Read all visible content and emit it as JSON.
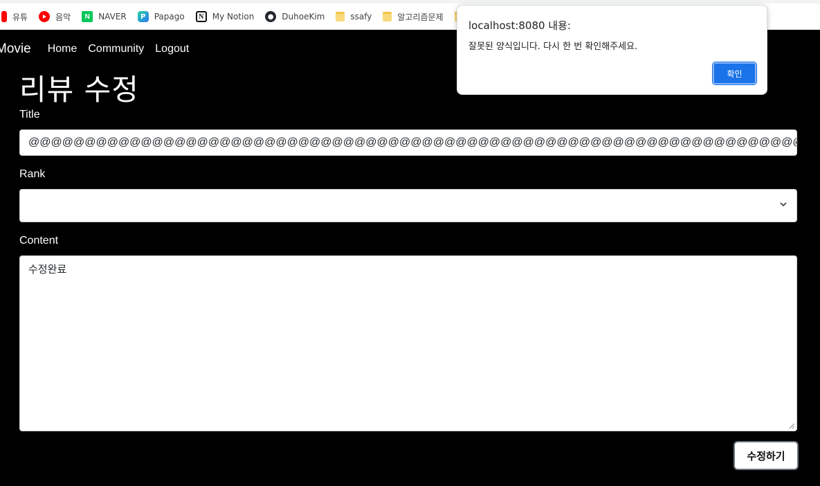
{
  "bookmarks": [
    {
      "label": "유튜",
      "icon": "youtube-icon"
    },
    {
      "label": "음악",
      "icon": "youtube-music-icon"
    },
    {
      "label": "NAVER",
      "icon": "naver-icon"
    },
    {
      "label": "Papago",
      "icon": "papago-icon"
    },
    {
      "label": "My Notion",
      "icon": "notion-icon"
    },
    {
      "label": "DuhoeKim",
      "icon": "github-icon"
    },
    {
      "label": "ssafy",
      "icon": "folder-icon"
    },
    {
      "label": "알고리즘문제",
      "icon": "folder-icon"
    },
    {
      "label": "",
      "icon": "folder-icon"
    }
  ],
  "nav": {
    "brand": "Movie",
    "links": [
      "Home",
      "Community",
      "Logout"
    ]
  },
  "page": {
    "title": "리뷰 수정"
  },
  "form": {
    "title_label": "Title",
    "title_value": "@@@@@@@@@@@@@@@@@@@@@@@@@@@@@@@@@@@@@@@@@@@@@@@@@@@@@@@@@@@@@@@@@@@@@@@@@@@@@",
    "rank_label": "Rank",
    "rank_value": "",
    "content_label": "Content",
    "content_value": "수정완료",
    "submit_label": "수정하기"
  },
  "dialog": {
    "origin": "localhost:8080 내용:",
    "message": "잘못된 양식입니다. 다시 한 번 확인해주세요.",
    "ok_label": "확인"
  },
  "colors": {
    "page_bg": "#000000",
    "dialog_button": "#1a73e8"
  }
}
